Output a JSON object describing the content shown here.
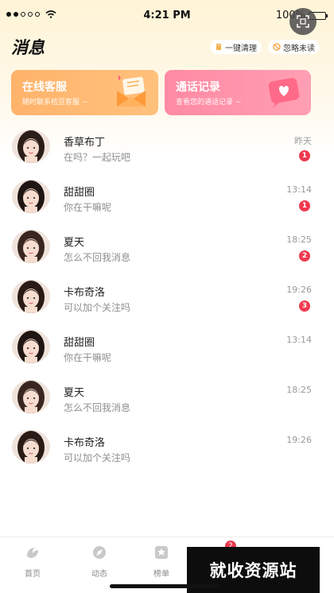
{
  "status_bar": {
    "time": "4:21 PM",
    "battery": "100%"
  },
  "header": {
    "title": "消息",
    "clear_all_label": "一键清理",
    "ignore_unread_label": "忽略未读"
  },
  "cards": {
    "service": {
      "title": "在线客服",
      "subtitle": "随时联系桔豆客服 ~"
    },
    "calls": {
      "title": "通话记录",
      "subtitle": "查看您的通话记录 ~"
    }
  },
  "messages": [
    {
      "name": "香草布丁",
      "preview": "在吗？一起玩吧",
      "time": "昨天",
      "badge": "1"
    },
    {
      "name": "甜甜圈",
      "preview": "你在干嘛呢",
      "time": "13:14",
      "badge": "1"
    },
    {
      "name": "夏天",
      "preview": "怎么不回我消息",
      "time": "18:25",
      "badge": "2"
    },
    {
      "name": "卡布奇洛",
      "preview": "可以加个关注吗",
      "time": "19:26",
      "badge": "3"
    },
    {
      "name": "甜甜圈",
      "preview": "你在干嘛呢",
      "time": "13:14",
      "badge": ""
    },
    {
      "name": "夏天",
      "preview": "怎么不回我消息",
      "time": "18:25",
      "badge": ""
    },
    {
      "name": "卡布奇洛",
      "preview": "可以加个关注吗",
      "time": "19:26",
      "badge": ""
    }
  ],
  "tabs": [
    {
      "label": "首页",
      "icon": "home-icon"
    },
    {
      "label": "动态",
      "icon": "compass-icon"
    },
    {
      "label": "榜单",
      "icon": "star-icon"
    }
  ],
  "tab_badge": "2",
  "watermark": "就收资源站",
  "colors": {
    "service_card": "#ffb36b",
    "calls_card": "#ff8aa3",
    "badge": "#f0394f",
    "header_bg": "#fff4d6"
  }
}
